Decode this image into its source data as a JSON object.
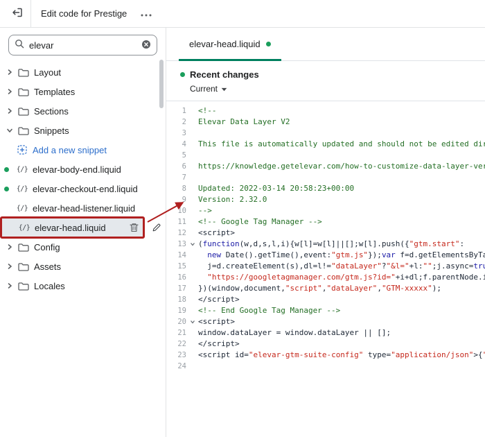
{
  "header": {
    "title": "Edit code for Prestige"
  },
  "sidebar": {
    "search": {
      "value": "elevar"
    },
    "tree": [
      {
        "type": "folder",
        "label": "Layout",
        "expanded": false
      },
      {
        "type": "folder",
        "label": "Templates",
        "expanded": false
      },
      {
        "type": "folder",
        "label": "Sections",
        "expanded": false
      },
      {
        "type": "folder",
        "label": "Snippets",
        "expanded": true
      },
      {
        "type": "action",
        "label": "Add a new snippet"
      },
      {
        "type": "file",
        "label": "elevar-body-end.liquid",
        "changed": true
      },
      {
        "type": "file",
        "label": "elevar-checkout-end.liquid",
        "changed": true
      },
      {
        "type": "file",
        "label": "elevar-head-listener.liquid",
        "changed": false
      },
      {
        "type": "file",
        "label": "elevar-head.liquid",
        "changed": false,
        "selected": true
      },
      {
        "type": "folder",
        "label": "Config",
        "expanded": false
      },
      {
        "type": "folder",
        "label": "Assets",
        "expanded": false
      },
      {
        "type": "folder",
        "label": "Locales",
        "expanded": false
      }
    ]
  },
  "main": {
    "tab": {
      "label": "elevar-head.liquid",
      "changed": true
    },
    "recent_changes": {
      "title": "Recent changes",
      "version_label": "Current"
    }
  },
  "editor": {
    "lines": [
      {
        "n": 1,
        "tokens": [
          [
            "c",
            "<!--"
          ]
        ]
      },
      {
        "n": 2,
        "tokens": [
          [
            "c",
            "Elevar Data Layer V2"
          ]
        ]
      },
      {
        "n": 3,
        "tokens": []
      },
      {
        "n": 4,
        "tokens": [
          [
            "c",
            "This file is automatically updated and should not be edited directly"
          ]
        ]
      },
      {
        "n": 5,
        "tokens": []
      },
      {
        "n": 6,
        "tokens": [
          [
            "c",
            "https://knowledge.getelevar.com/how-to-customize-data-layer-version"
          ]
        ]
      },
      {
        "n": 7,
        "tokens": []
      },
      {
        "n": 8,
        "tokens": [
          [
            "c",
            "Updated: 2022-03-14 20:58:23+00:00"
          ]
        ]
      },
      {
        "n": 9,
        "tokens": [
          [
            "c",
            "Version: 2.32.0"
          ]
        ]
      },
      {
        "n": 10,
        "tokens": [
          [
            "c",
            "-->"
          ]
        ]
      },
      {
        "n": 11,
        "tokens": [
          [
            "c",
            "<!-- Google Tag Manager -->"
          ]
        ]
      },
      {
        "n": 12,
        "tokens": [
          [
            "p",
            "<script>"
          ]
        ]
      },
      {
        "n": 13,
        "fold": true,
        "tokens": [
          [
            "p",
            "("
          ],
          [
            "k",
            "function"
          ],
          [
            "p",
            "(w,d,s,l,i){w[l]=w[l]||[];w[l].push({"
          ],
          [
            "s",
            "\"gtm.start\""
          ],
          [
            "p",
            ":"
          ]
        ]
      },
      {
        "n": 14,
        "tokens": [
          [
            "p",
            "  "
          ],
          [
            "k",
            "new"
          ],
          [
            "p",
            " Date().getTime(),event:"
          ],
          [
            "s",
            "\"gtm.js\""
          ],
          [
            "p",
            "});"
          ],
          [
            "k",
            "var"
          ],
          [
            "p",
            " f=d.getElementsByTagName(s),"
          ]
        ]
      },
      {
        "n": 15,
        "tokens": [
          [
            "p",
            "  j=d.createElement(s),dl=l!="
          ],
          [
            "s",
            "\"dataLayer\""
          ],
          [
            "p",
            "?"
          ],
          [
            "s",
            "\"&l=\""
          ],
          [
            "p",
            "+l:"
          ],
          [
            "s",
            "\"\""
          ],
          [
            "p",
            ";j.async="
          ],
          [
            "k",
            "true"
          ],
          [
            "p",
            ";"
          ]
        ]
      },
      {
        "n": 16,
        "tokens": [
          [
            "p",
            "  "
          ],
          [
            "s",
            "\"https://googletagmanager.com/gtm.js?id=\""
          ],
          [
            "p",
            "+i+dl;f.parentNode.insertBefore(j,f);"
          ]
        ]
      },
      {
        "n": 17,
        "tokens": [
          [
            "p",
            "})(window,document,"
          ],
          [
            "s",
            "\"script\""
          ],
          [
            "p",
            ","
          ],
          [
            "s",
            "\"dataLayer\""
          ],
          [
            "p",
            ","
          ],
          [
            "s",
            "\"GTM-xxxxx\""
          ],
          [
            "p",
            ");"
          ]
        ]
      },
      {
        "n": 18,
        "tokens": [
          [
            "p",
            "</script>"
          ]
        ]
      },
      {
        "n": 19,
        "tokens": [
          [
            "c",
            "<!-- End Google Tag Manager -->"
          ]
        ]
      },
      {
        "n": 20,
        "fold": true,
        "tokens": [
          [
            "p",
            "<script>"
          ]
        ]
      },
      {
        "n": 21,
        "tokens": [
          [
            "p",
            "window.dataLayer = window.dataLayer || [];"
          ]
        ]
      },
      {
        "n": 22,
        "tokens": [
          [
            "p",
            "</script>"
          ]
        ]
      },
      {
        "n": 23,
        "tokens": [
          [
            "p",
            "<script id="
          ],
          [
            "s",
            "\"elevar-gtm-suite-config\""
          ],
          [
            "p",
            " type="
          ],
          [
            "s",
            "\"application/json\""
          ],
          [
            "p",
            ">{"
          ],
          [
            "s",
            "\"gtm"
          ]
        ]
      },
      {
        "n": 24,
        "tokens": []
      }
    ]
  },
  "colors": {
    "accent_green": "#1a9e5c",
    "tab_underline": "#00805f",
    "link_blue": "#2c6ecb",
    "annotation_red": "#b02020",
    "selected_bg": "#e4e8ec",
    "comment_green": "#236e24",
    "string_red": "#c5281c",
    "keyword_blue": "#1a1aa6",
    "code_text": "#202a38",
    "gutter_gray": "#9aa0a6"
  }
}
